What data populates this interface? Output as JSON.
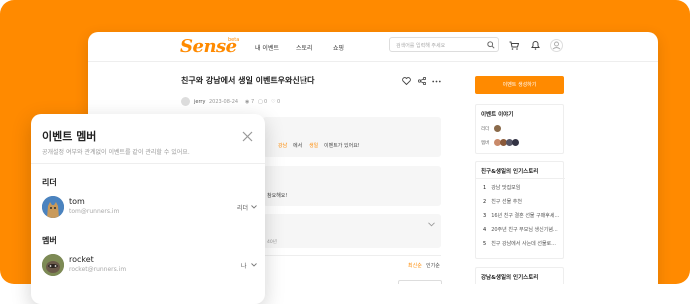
{
  "colors": {
    "brand": "#ff8a00",
    "text": "#222222",
    "muted": "#999999"
  },
  "header": {
    "logo_text": "Sense",
    "logo_badge": "beta",
    "nav": [
      "내 이벤트",
      "스토리",
      "쇼핑"
    ],
    "search_placeholder": "검색어를 입력해 주세요",
    "icons": [
      "search-icon",
      "cart-icon",
      "bell-icon",
      "profile-icon"
    ]
  },
  "post": {
    "title": "친구와 강남에서 생일 이벤트우와신난다",
    "author": "jerry",
    "date": "2023-08-24",
    "views": "7",
    "comments": "0",
    "likes": "0",
    "info_tags": [
      "강남",
      "에서",
      "생일",
      "이벤트가 있어요!"
    ],
    "card2_text": "참요해요!",
    "card3_text": "40년",
    "sort": [
      "최신순",
      "인기순"
    ]
  },
  "sidebar": {
    "create_button": "이벤트 생성하기",
    "story_title": "이벤트 이야기",
    "row1_label": "리더",
    "row2_label": "멤버",
    "popular1_title": "친구&생일의 인기스토리",
    "popular1_items": [
      {
        "num": "1",
        "text": "강남 맛집모임"
      },
      {
        "num": "2",
        "text": "친구 선물 추천"
      },
      {
        "num": "3",
        "text": "16년 친구 결혼 선물 구매후세..."
      },
      {
        "num": "4",
        "text": "20주년 친구 부모님 생신기념..."
      },
      {
        "num": "5",
        "text": "친구 강남에서 사는데 선물로..."
      }
    ],
    "popular2_title": "강남&생일의 인기스토리"
  },
  "modal": {
    "title": "이벤트 멤버",
    "subtitle": "공개설정 여부와 관계없이 이벤트를 같이 관리할 수 있어요.",
    "leader_section": "리더",
    "member_section": "멤버",
    "leader": {
      "name": "tom",
      "email": "tom@runners.im",
      "role": "리더"
    },
    "member": {
      "name": "rocket",
      "email": "rocket@runners.im",
      "role": "나"
    }
  }
}
